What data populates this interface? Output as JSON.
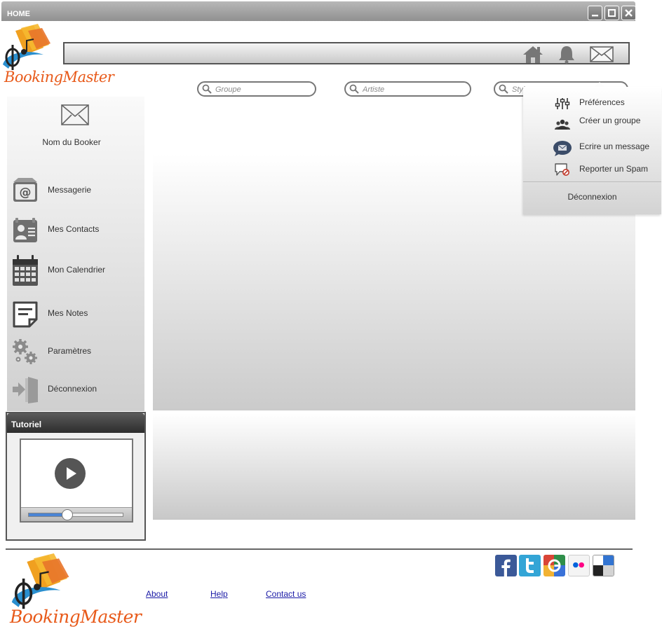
{
  "window": {
    "title": "HOME",
    "controls": [
      "minimize",
      "maximize",
      "close"
    ]
  },
  "brand": {
    "name": "BookingMaster"
  },
  "toolbar": {
    "icons": [
      "home-icon",
      "bell-icon",
      "envelope-icon"
    ]
  },
  "search": {
    "groupe_placeholder": "Groupe",
    "artiste_placeholder": "Artiste",
    "style_placeholder": "Style"
  },
  "sidebar": {
    "booker_name": "Nom du Booker",
    "items": [
      {
        "label": "Messagerie",
        "icon": "at-mail-icon"
      },
      {
        "label": "Mes Contacts",
        "icon": "contact-card-icon"
      },
      {
        "label": "Mon Calendrier",
        "icon": "calendar-icon"
      },
      {
        "label": "Mes Notes",
        "icon": "note-icon"
      },
      {
        "label": "Paramètres",
        "icon": "gears-icon"
      },
      {
        "label": "Déconnexion",
        "icon": "logout-door-icon"
      }
    ]
  },
  "dropdown": {
    "items": [
      {
        "label": "Préférences",
        "icon": "sliders-icon"
      },
      {
        "label": "Créer un groupe",
        "icon": "group-icon"
      },
      {
        "label": "Ecrire un message",
        "icon": "message-bubble-icon"
      },
      {
        "label": "Reporter un Spam",
        "icon": "spam-report-icon"
      }
    ],
    "logout_label": "Déconnexion"
  },
  "tutorial": {
    "title": "Tutoriel",
    "progress": 0.42
  },
  "footer": {
    "links": [
      "About",
      "Help",
      "Contact us"
    ],
    "social": [
      "facebook-icon",
      "twitter-icon",
      "google-icon",
      "flickr-icon",
      "delicious-icon"
    ]
  },
  "colors": {
    "accent_orange": "#e85a1a",
    "progress_blue": "#4a84d4",
    "facebook": "#3b5998",
    "twitter": "#33a5d6"
  }
}
